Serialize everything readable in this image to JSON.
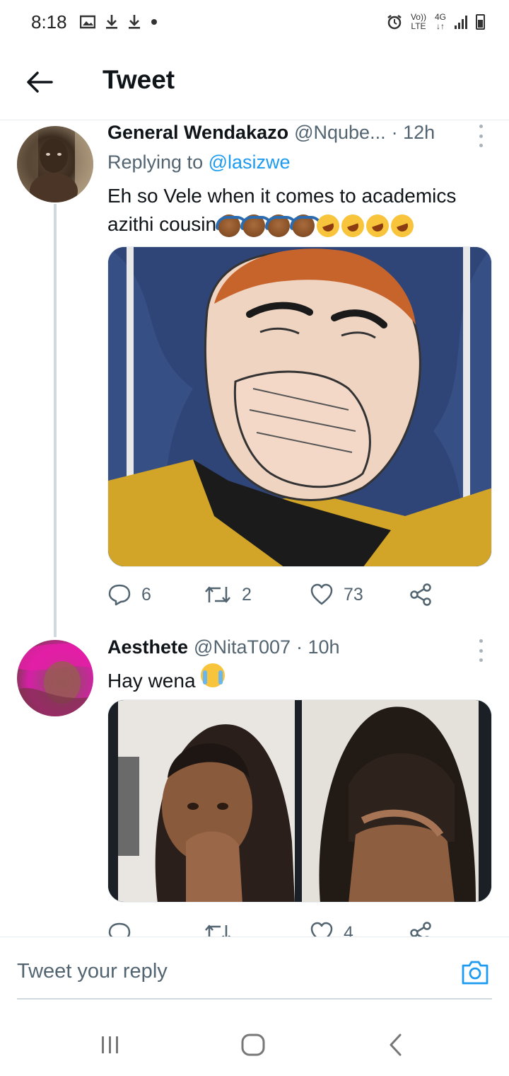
{
  "status_bar": {
    "time": "8:18",
    "left_icons": [
      "gallery-icon",
      "download-icon",
      "download-icon",
      "dot-icon"
    ],
    "right_icons": [
      "alarm-icon",
      "volte-icon",
      "4g-icon",
      "signal-icon",
      "battery-icon"
    ],
    "volte_top": "Vo))",
    "volte_bottom": "LTE",
    "net_top": "4G",
    "net_bottom": "↓↑"
  },
  "header": {
    "title": "Tweet",
    "back_icon": "arrow-left-icon"
  },
  "tweets": [
    {
      "name": "General Wendakazo",
      "handle": "@Nqube...",
      "time": "· 12h",
      "replying_prefix": "Replying to ",
      "replying_to": "@lasizwe",
      "text_line1": "Eh so Vele when it comes to academics",
      "text_line2": "azithi cousin",
      "emojis": [
        "person-gesturing-ok",
        "person-gesturing-ok",
        "person-gesturing-ok",
        "person-gesturing-ok",
        "rolling-laughing",
        "rolling-laughing",
        "rolling-laughing",
        "rolling-laughing"
      ],
      "replies": "6",
      "retweets": "2",
      "likes": "73"
    },
    {
      "name": "Aesthete",
      "handle": "@NitaT007",
      "time": "· 10h",
      "text": "Hay wena",
      "emojis": [
        "loudly-crying-face"
      ],
      "replies": "",
      "retweets": "",
      "likes": "4"
    }
  ],
  "reply_box": {
    "placeholder": "Tweet your reply",
    "camera_icon": "camera-icon"
  },
  "nav_bar": {
    "icons": [
      "recents-icon",
      "home-icon",
      "back-icon"
    ]
  },
  "colors": {
    "accent": "#1d9bf0",
    "text": "#0f1419",
    "muted": "#536471",
    "divider": "#e6ecf0"
  }
}
